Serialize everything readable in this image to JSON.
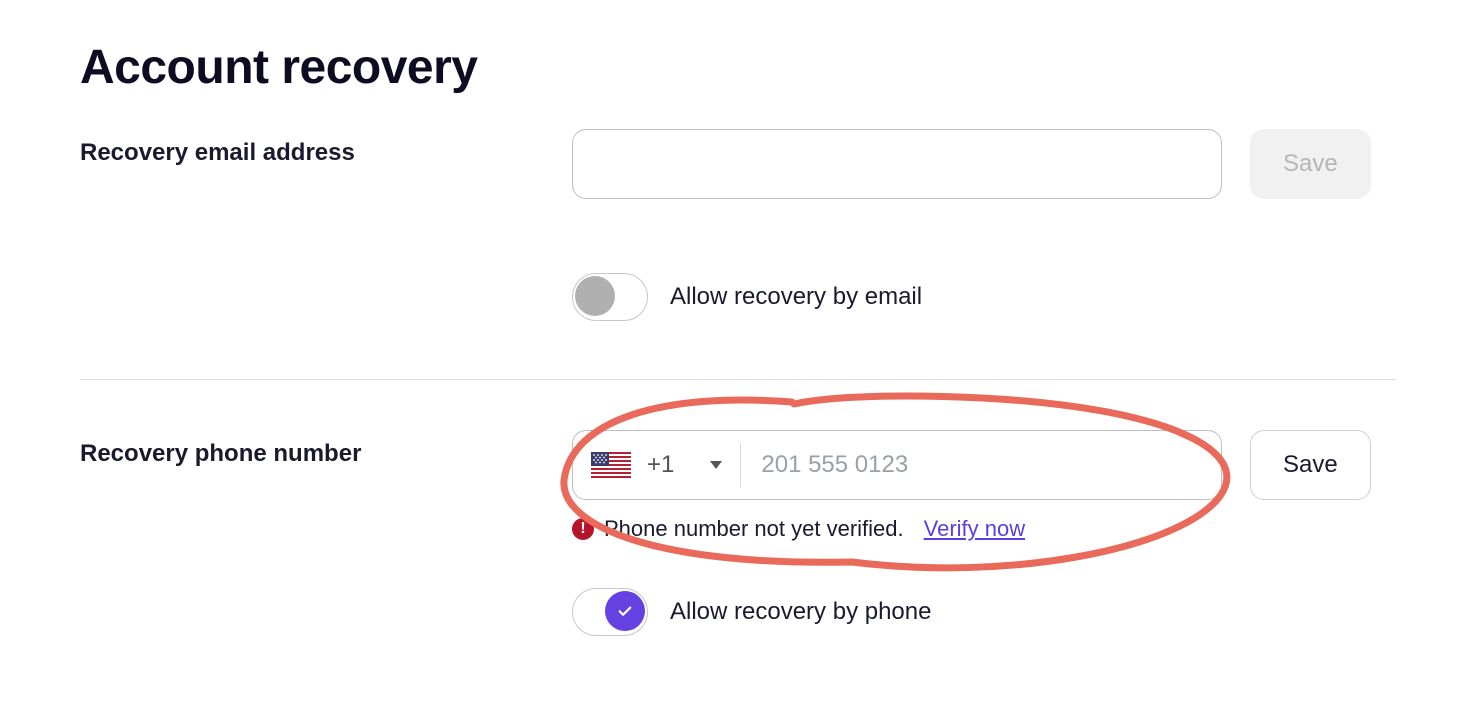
{
  "title": "Account recovery",
  "email_section": {
    "label": "Recovery email address",
    "value": "",
    "save_label": "Save",
    "toggle_label": "Allow recovery by email",
    "toggle_on": false
  },
  "phone_section": {
    "label": "Recovery phone number",
    "country_code": "+1",
    "country_flag": "us",
    "placeholder": "201 555 0123",
    "value": "",
    "save_label": "Save",
    "verify_message": "Phone number not yet verified.",
    "verify_link_label": "Verify now",
    "toggle_label": "Allow recovery by phone",
    "toggle_on": true
  }
}
